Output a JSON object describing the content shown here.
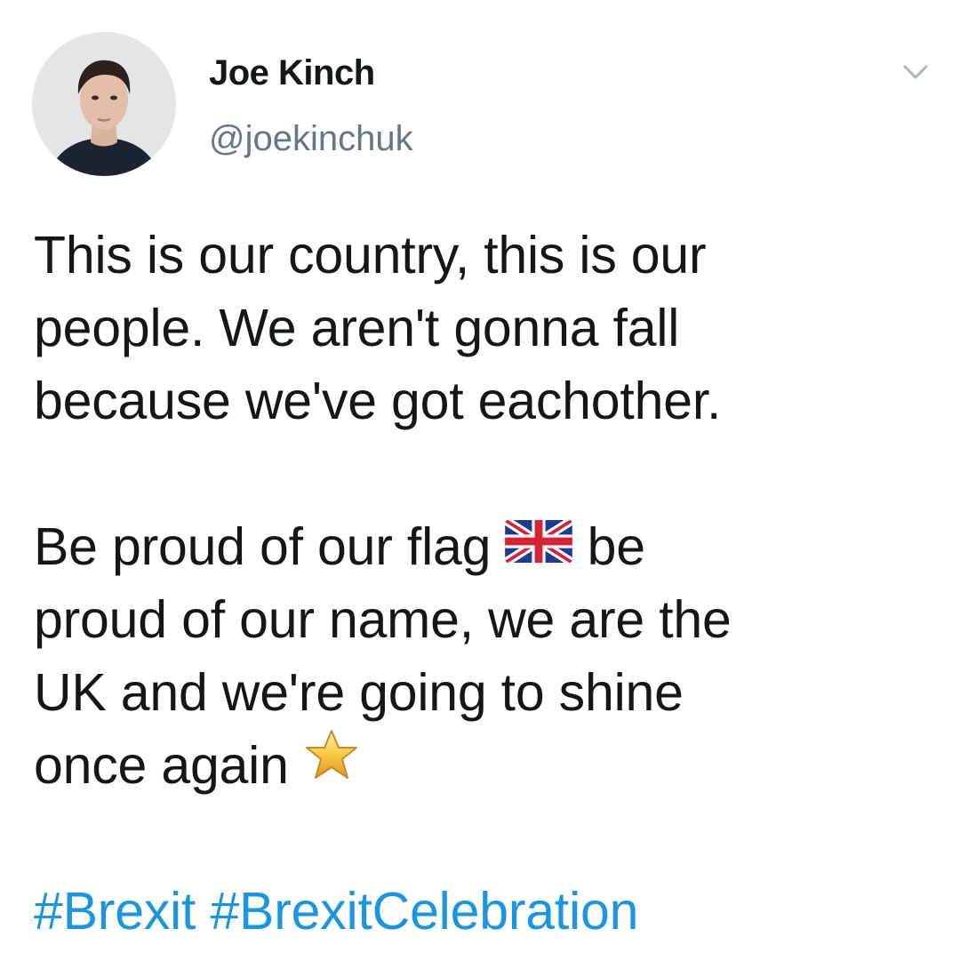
{
  "author": {
    "name": "Joe Kinch",
    "handle": "@joekinchuk"
  },
  "tweet": {
    "lines_paragraph1": [
      "This is our country, this is our",
      "people. We aren't gonna fall",
      "because we've got eachother."
    ],
    "p2_line1_before_flag": "Be proud of our flag",
    "p2_line1_after_flag": "be",
    "p2_line2": "proud of our name, we are the",
    "p2_line3": "UK and we're going to shine",
    "p2_line4": "once again",
    "hashtags": [
      "#Brexit",
      "#BrexitCelebration"
    ]
  },
  "icons": {
    "menu": "chevron-down-icon",
    "flag": "uk-flag-emoji",
    "star": "star-emoji"
  },
  "colors": {
    "text": "#14171a",
    "secondary": "#657786",
    "link": "#1b95e0"
  }
}
